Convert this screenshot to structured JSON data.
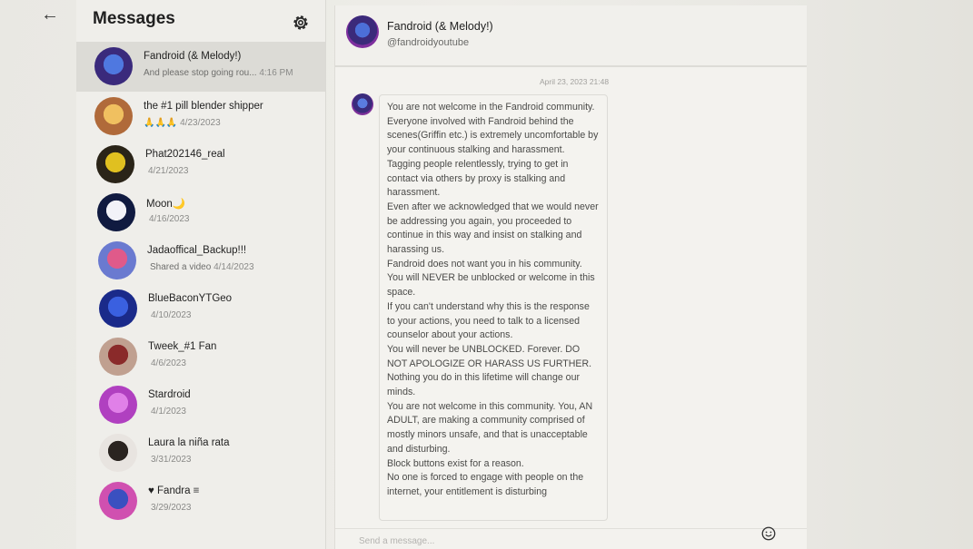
{
  "sidebar": {
    "title": "Messages",
    "conversations": [
      {
        "name": "Fandroid (& Melody!)",
        "preview": "And please stop going rou...",
        "time": "4:16 PM",
        "colors": [
          "#3a2a7c",
          "#4f78e0"
        ]
      },
      {
        "name": "the #1 pill blender shipper",
        "preview": "🙏🙏🙏",
        "time": "4/23/2023",
        "colors": [
          "#b06a3a",
          "#f0c060"
        ]
      },
      {
        "name": "Phat202146_real",
        "preview": "",
        "time": "4/21/2023",
        "colors": [
          "#2a2418",
          "#e0c020"
        ]
      },
      {
        "name": "Moon🌙",
        "preview": "",
        "time": "4/16/2023",
        "colors": [
          "#101a40",
          "#f2f2f8"
        ]
      },
      {
        "name": "Jadaoffical_Backup!!!",
        "preview": "Shared a video",
        "time": "4/14/2023",
        "colors": [
          "#6a7ad0",
          "#e05a8a"
        ]
      },
      {
        "name": "BlueBaconYTGeo",
        "preview": "",
        "time": "4/10/2023",
        "colors": [
          "#1a2a8a",
          "#3a60e0"
        ]
      },
      {
        "name": "Tweek_#1 Fan",
        "preview": "",
        "time": "4/6/2023",
        "colors": [
          "#c0a090",
          "#8a2a2a"
        ]
      },
      {
        "name": "Stardroid",
        "preview": "",
        "time": "4/1/2023",
        "colors": [
          "#b040c0",
          "#e080e8"
        ]
      },
      {
        "name": "Laura la niña rata",
        "preview": "",
        "time": "3/31/2023",
        "colors": [
          "#e8e4e0",
          "#2a2420"
        ]
      },
      {
        "name": "♥ Fandra ≡",
        "preview": "",
        "time": "3/29/2023",
        "colors": [
          "#d050b0",
          "#3a50c0"
        ]
      }
    ]
  },
  "chat": {
    "name": "Fandroid (& Melody!)",
    "handle": "@fandroidyoutube",
    "timestamp": "April 23, 2023 21:48",
    "message": "You are not welcome in the Fandroid community.\nEveryone involved with Fandroid behind the scenes(Griffin etc.) is extremely uncomfortable by your continuous stalking and harassment.\nTagging people relentlessly, trying to get in contact via others by proxy is stalking and harassment.\nEven after we acknowledged that we would never be addressing you again, you proceeded to continue in this way and insist on stalking and harassing us.\nFandroid does not want you in his community. You will NEVER be unblocked or welcome in this space.\nIf you can't understand why this is the response to your actions, you need to talk to a licensed counselor about your actions.\nYou will never be UNBLOCKED. Forever. DO NOT APOLOGIZE OR HARASS US FURTHER.\nNothing you do in this lifetime will change our minds.\nYou are not welcome in this community. You, AN ADULT, are making a community comprised of mostly minors unsafe, and that is unacceptable and disturbing.\nBlock buttons exist for a reason.\nNo one is forced to engage with people on the internet, your entitlement is disturbing",
    "composer_placeholder": "Send a message..."
  }
}
